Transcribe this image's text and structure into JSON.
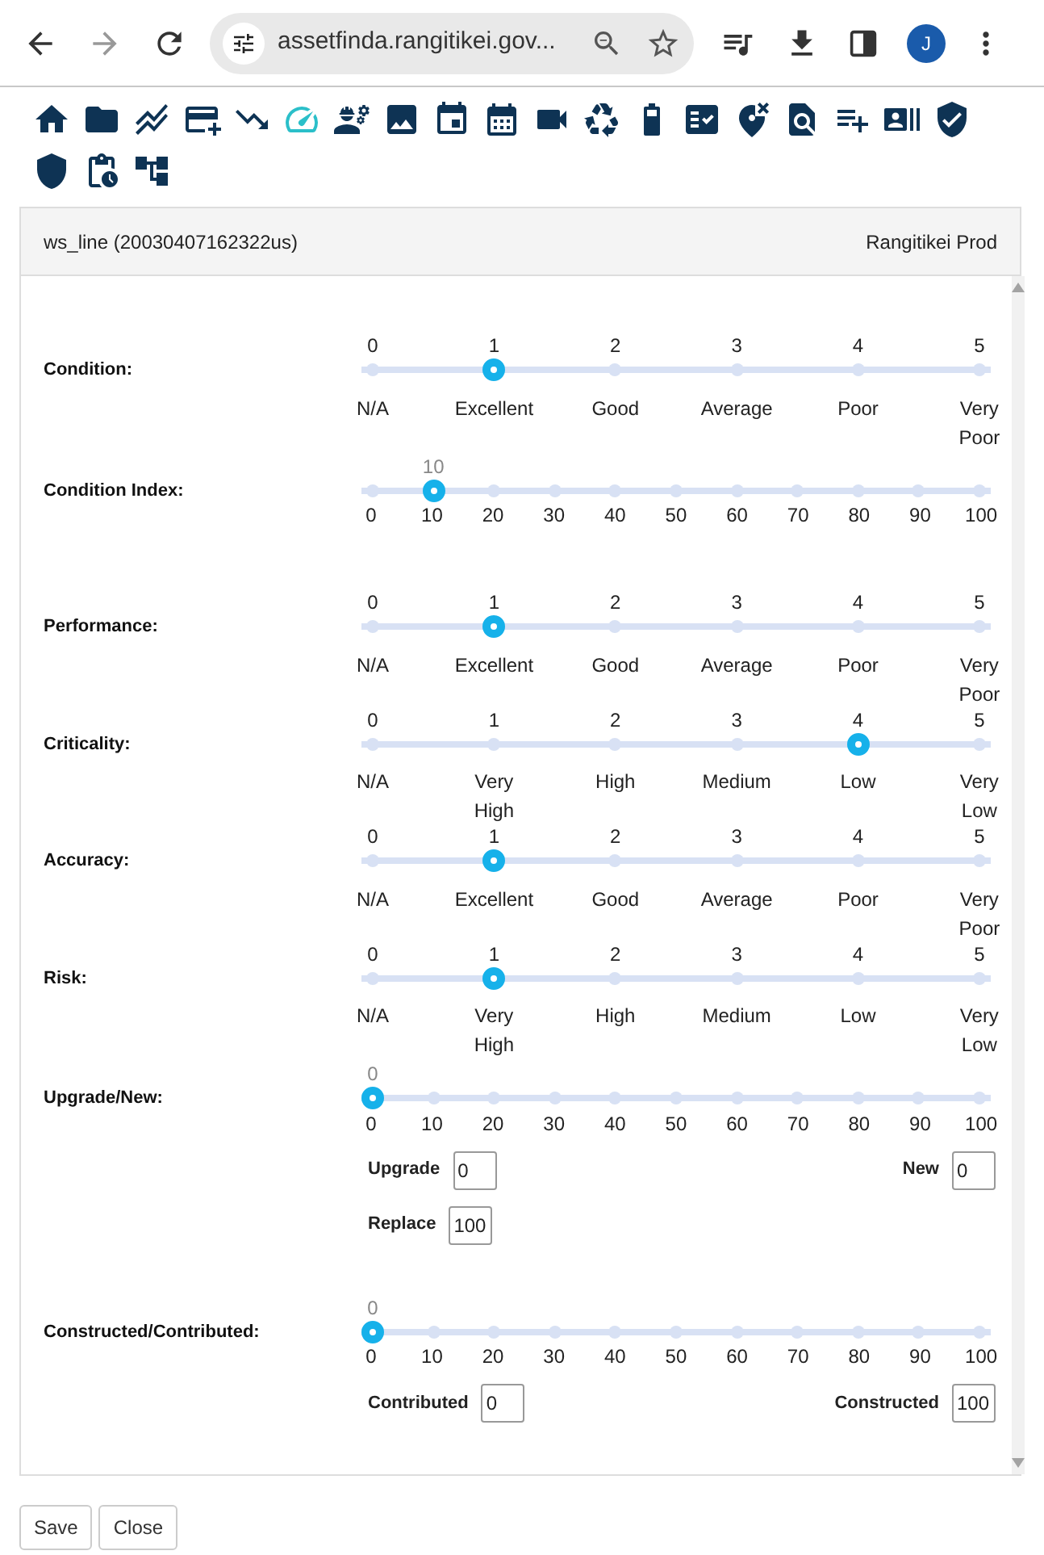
{
  "browser": {
    "url": "assetfinda.rangitikei.gov...",
    "avatar": "J"
  },
  "panel": {
    "title": "ws_line (20030407162322us)",
    "environment": "Rangitikei Prod"
  },
  "fields": [
    {
      "label": "Condition:",
      "kind": "scale",
      "ticks": [
        "0",
        "1",
        "2",
        "3",
        "4",
        "5"
      ],
      "captions": [
        "N/A",
        "Excellent",
        "Good",
        "Average",
        "Poor",
        "Very Poor"
      ],
      "level": 0.2
    },
    {
      "label": "Condition Index:",
      "kind": "range",
      "value_label": "10",
      "ticks": [
        "0",
        "10",
        "20",
        "30",
        "40",
        "50",
        "60",
        "70",
        "80",
        "90",
        "100"
      ],
      "level": 0.1
    },
    {
      "label": "Performance:",
      "kind": "scale",
      "ticks": [
        "0",
        "1",
        "2",
        "3",
        "4",
        "5"
      ],
      "captions": [
        "N/A",
        "Excellent",
        "Good",
        "Average",
        "Poor",
        "Very Poor"
      ],
      "level": 0.2
    },
    {
      "label": "Criticality:",
      "kind": "scale",
      "ticks": [
        "0",
        "1",
        "2",
        "3",
        "4",
        "5"
      ],
      "captions": [
        "N/A",
        "Very High",
        "High",
        "Medium",
        "Low",
        "Very Low"
      ],
      "level": 0.8
    },
    {
      "label": "Accuracy:",
      "kind": "scale",
      "ticks": [
        "0",
        "1",
        "2",
        "3",
        "4",
        "5"
      ],
      "captions": [
        "N/A",
        "Excellent",
        "Good",
        "Average",
        "Poor",
        "Very Poor"
      ],
      "level": 0.2
    },
    {
      "label": "Risk:",
      "kind": "scale",
      "ticks": [
        "0",
        "1",
        "2",
        "3",
        "4",
        "5"
      ],
      "captions": [
        "N/A",
        "Very High",
        "High",
        "Medium",
        "Low",
        "Very Low"
      ],
      "level": 0.2
    },
    {
      "label": "Upgrade/New:",
      "kind": "range",
      "value_label": "0",
      "ticks": [
        "0",
        "10",
        "20",
        "30",
        "40",
        "50",
        "60",
        "70",
        "80",
        "90",
        "100"
      ],
      "level": 0,
      "input_rows": [
        [
          {
            "label": "Upgrade",
            "value": "0"
          },
          {
            "label": "New",
            "value": "0"
          }
        ],
        [
          {
            "label": "Replace",
            "value": "100"
          }
        ]
      ]
    },
    {
      "label": "Constructed/Contributed:",
      "kind": "range",
      "value_label": "0",
      "ticks": [
        "0",
        "10",
        "20",
        "30",
        "40",
        "50",
        "60",
        "70",
        "80",
        "90",
        "100"
      ],
      "level": 0,
      "input_rows": [
        [
          {
            "label": "Contributed",
            "value": "0"
          },
          {
            "label": "Constructed",
            "value": "100"
          }
        ]
      ]
    }
  ],
  "buttons": [
    "Save",
    "Close"
  ]
}
